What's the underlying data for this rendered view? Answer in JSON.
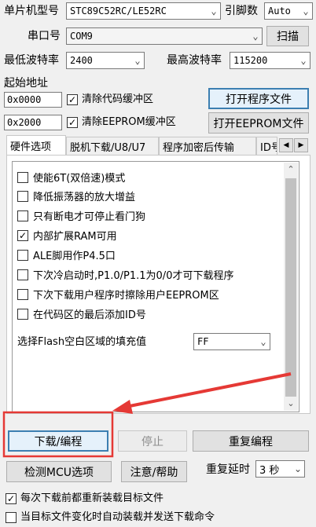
{
  "top": {
    "mcu_label": "单片机型号",
    "mcu_value": "STC89C52RC/LE52RC",
    "pin_label": "引脚数",
    "pin_value": "Auto",
    "port_label": "串口号",
    "port_value": "COM9",
    "scan_button": "扫描",
    "min_baud_label": "最低波特率",
    "min_baud_value": "2400",
    "max_baud_label": "最高波特率",
    "max_baud_value": "115200"
  },
  "address": {
    "start_label": "起始地址",
    "code_addr": "0x0000",
    "clear_code_label": "清除代码缓冲区",
    "open_program_button": "打开程序文件",
    "eeprom_addr": "0x2000",
    "clear_eeprom_label": "清除EEPROM缓冲区",
    "open_eeprom_button": "打开EEPROM文件"
  },
  "tabs": [
    "硬件选项",
    "脱机下载/U8/U7",
    "程序加密后传输",
    "ID号"
  ],
  "options": [
    {
      "label": "使能6T(双倍速)模式",
      "checked": false
    },
    {
      "label": "降低振荡器的放大增益",
      "checked": false
    },
    {
      "label": "只有断电才可停止看门狗",
      "checked": false
    },
    {
      "label": "内部扩展RAM可用",
      "checked": true
    },
    {
      "label": "ALE脚用作P4.5口",
      "checked": false
    },
    {
      "label": "下次冷启动时,P1.0/P1.1为0/0才可下载程序",
      "checked": false
    },
    {
      "label": "下次下载用户程序时擦除用户EEPROM区",
      "checked": false
    },
    {
      "label": "在代码区的最后添加ID号",
      "checked": false
    }
  ],
  "fill": {
    "label": "选择Flash空白区域的填充值",
    "value": "FF"
  },
  "actions": {
    "download": "下载/编程",
    "stop": "停止",
    "reprogram": "重复编程",
    "check_mcu": "检测MCU选项",
    "help": "注意/帮助",
    "repeat_delay_label": "重复延时",
    "repeat_delay_value": "3 秒"
  },
  "bottom": {
    "reload_label": "每次下载前都重新装载目标文件",
    "reload_checked": true,
    "auto_label": "当目标文件变化时自动装载并发送下载命令",
    "auto_checked": false
  },
  "colors": {
    "highlight": "#e53935",
    "accent": "#3c7fb1"
  }
}
